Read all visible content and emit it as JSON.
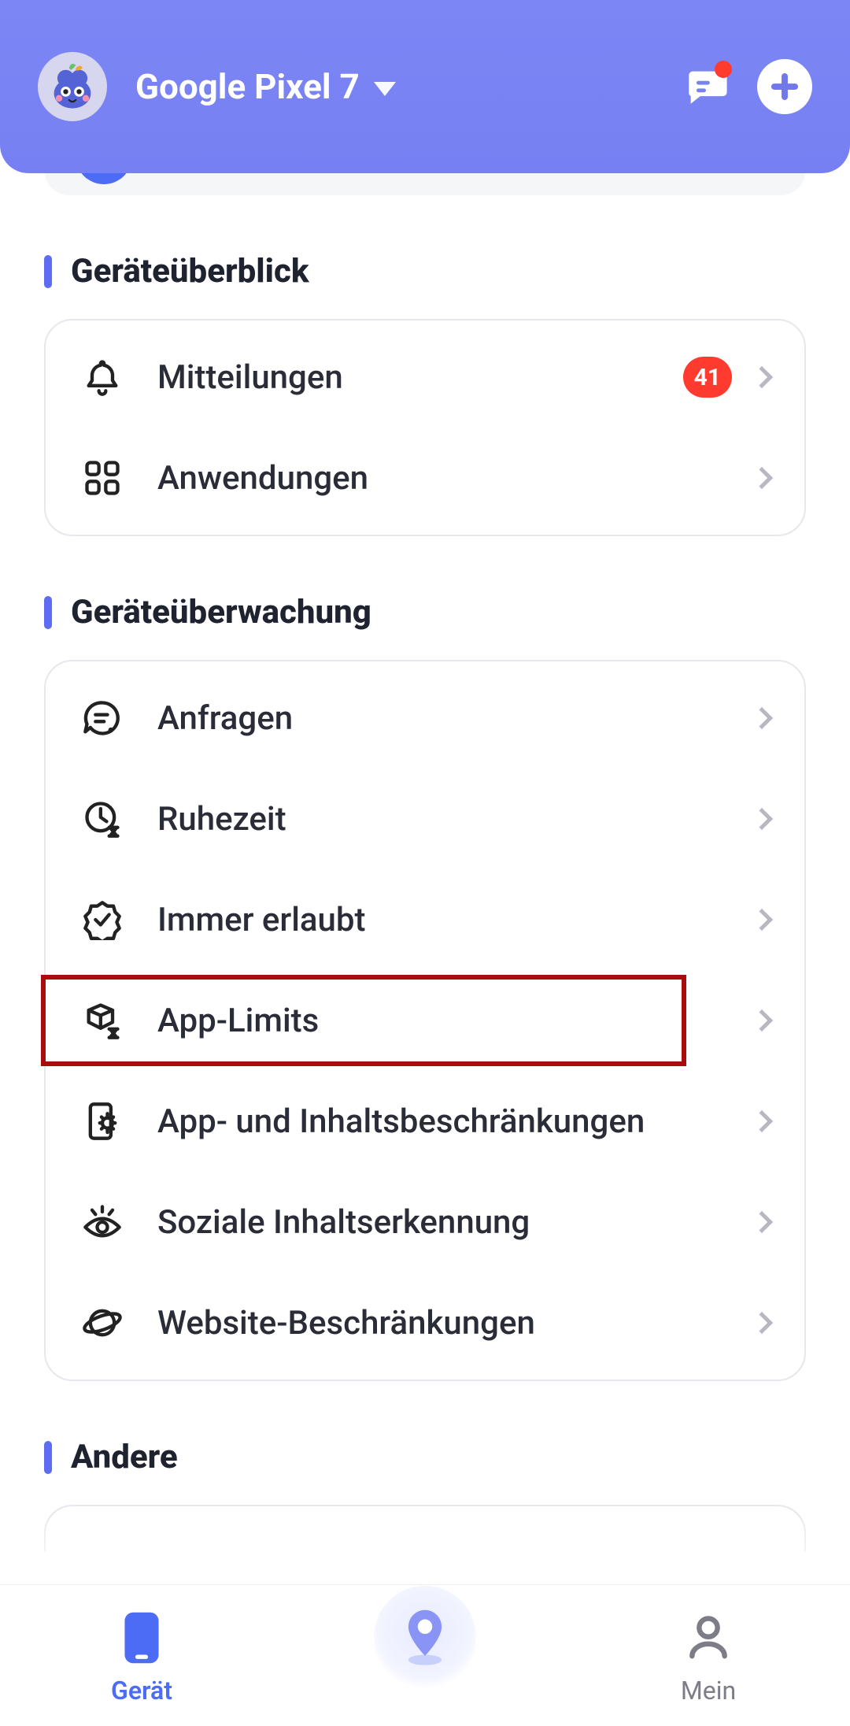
{
  "header": {
    "device_name": "Google Pixel 7"
  },
  "sections": {
    "overview_title": "Geräteüberblick",
    "monitoring_title": "Geräteüberwachung",
    "other_title": "Andere"
  },
  "overview": {
    "notifications_label": "Mitteilungen",
    "notifications_count": "41",
    "apps_label": "Anwendungen"
  },
  "monitoring": {
    "requests": "Anfragen",
    "downtime": "Ruhezeit",
    "always_allowed": "Immer erlaubt",
    "app_limits": "App-Limits",
    "content_restrictions": "App- und Inhaltsbeschränkungen",
    "social_detect": "Soziale Inhaltserkennung",
    "website_restrictions": "Website-Beschränkungen"
  },
  "nav": {
    "device": "Gerät",
    "mine": "Mein"
  },
  "colors": {
    "primary": "#5e6cf2",
    "accent_red": "#ff3b30",
    "highlight_border": "#a90c0c"
  }
}
